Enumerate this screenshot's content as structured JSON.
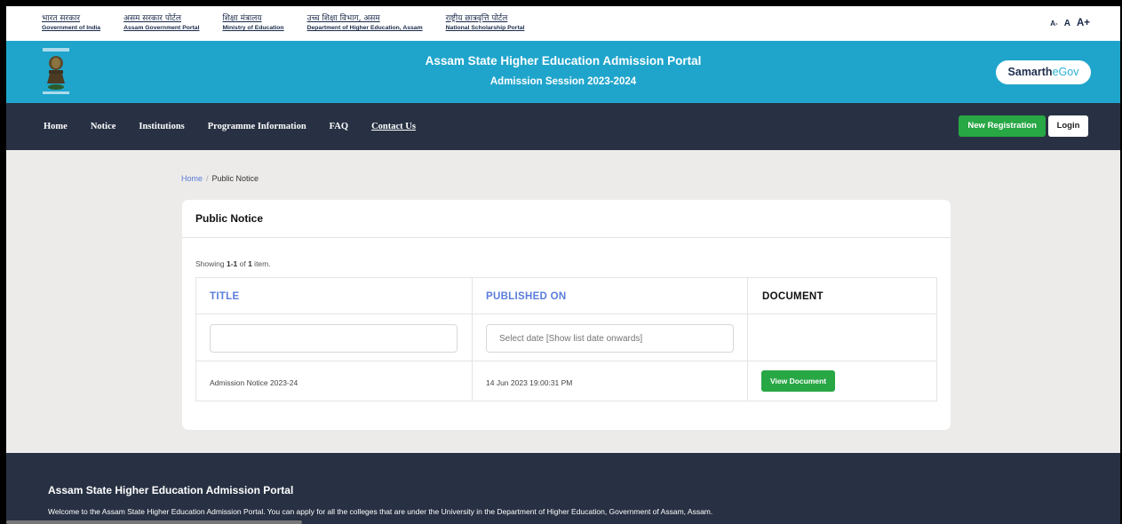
{
  "gov_links": [
    {
      "hi": "भारत सरकार",
      "en": "Government of India"
    },
    {
      "hi": "असम सरकार पोर्टल",
      "en": "Assam Government Portal"
    },
    {
      "hi": "शिक्षा मंत्रालय",
      "en": "Ministry of Education"
    },
    {
      "hi": "उच्च शिक्षा विभाग, असम",
      "en": "Department of Higher Education, Assam"
    },
    {
      "hi": "राष्ट्रीय छात्रवृत्ति पोर्टल",
      "en": "National Scholarship Portal"
    }
  ],
  "font_size": {
    "small": "A-",
    "normal": "A",
    "large": "A+"
  },
  "header": {
    "title": "Assam State Higher Education Admission Portal",
    "subtitle": "Admission Session 2023-2024",
    "brand_part1": "Samarth",
    "brand_part2": "eGov"
  },
  "nav": {
    "items": [
      "Home",
      "Notice",
      "Institutions",
      "Programme Information",
      "FAQ",
      "Contact Us"
    ],
    "register": "New Registration",
    "login": "Login"
  },
  "breadcrumb": {
    "home": "Home",
    "separator": "/",
    "current": "Public Notice"
  },
  "notice": {
    "title": "Public Notice",
    "summary_prefix": "Showing ",
    "summary_range": "1-1",
    "summary_of": " of ",
    "summary_total": "1",
    "summary_suffix": " item.",
    "columns": [
      "TITLE",
      "PUBLISHED ON",
      "DOCUMENT"
    ],
    "filter_title_value": "",
    "filter_date_placeholder": "Select date [Show list date onwards]",
    "rows": [
      {
        "title": "Admission Notice 2023-24",
        "published_on": "14 Jun 2023 19:00:31 PM",
        "document": "View Document"
      }
    ]
  },
  "footer": {
    "title": "Assam State Higher Education Admission Portal",
    "text": "Welcome to the Assam State Higher Education Admission Portal. You can apply for all the colleges that are under the University in the Department of Higher Education, Government of Assam, Assam."
  },
  "colors": {
    "header_bg": "#1fa5cc",
    "nav_bg": "#283143",
    "accent_green": "#28a745",
    "link_blue": "#5b7ddc"
  }
}
